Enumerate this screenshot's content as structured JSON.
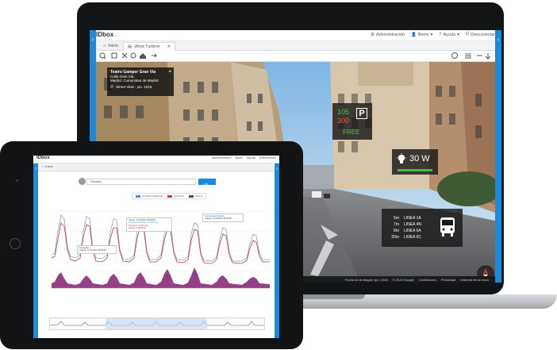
{
  "desktop_app": {
    "logo": "IDbox",
    "logo_suffix": "...",
    "menu": {
      "admin": "Administración",
      "user": "Bienv",
      "help": "Ayuda",
      "logout": "Desconectar"
    },
    "tabs": [
      {
        "label": "Inicio"
      },
      {
        "label": "Wind Turbine"
      }
    ],
    "place_card": {
      "title": "Teatro Gamper Gran Vía",
      "line1": "Calle Gran Vía",
      "line2": "Madrid, Comunidad de Madrid",
      "line3": "Street View - jun. 2016"
    },
    "parking": {
      "count_a": "105",
      "count_b": "300",
      "status": "FREE",
      "symbol": "P"
    },
    "streetlight": {
      "power": "30 W"
    },
    "bus_schedule": [
      {
        "time": "5m",
        "line": "LINEA 1A"
      },
      {
        "time": "7m",
        "line": "LINEA 4N"
      },
      {
        "time": "8m",
        "line": "LINEA 6A"
      },
      {
        "time": "20m",
        "line": "LINEA 6C"
      }
    ],
    "footer": {
      "date": "Fecha de la imagen: jun. 2016",
      "copyright": "© 2019 Google",
      "conditions": "Condiciones",
      "privacy": "Privacidad",
      "report": "Informar de un error"
    },
    "colors": {
      "accent": "#1c8ad8",
      "available": "#42c24a",
      "occupied": "#ff5a3c"
    }
  },
  "tablet_app": {
    "logo": "IDbox",
    "logo_suffix": "...",
    "menu": {
      "admin": "Administración",
      "user": "Bienv",
      "help": "Ayuda",
      "logout": "Desconectar"
    },
    "tab": "Inicio",
    "search": {
      "value": "Variable"
    },
    "legend": [
      {
        "label": "Consumo Estimado",
        "color": "#4f8fd9"
      },
      {
        "label": "Consumo",
        "color": "#c83c3c"
      },
      {
        "label": "Desvío",
        "color": "#8a2a7a"
      }
    ],
    "tooltip_left": {
      "title": "Consumo",
      "l1": "Jueves, 17 Octubre 18:00:00"
    },
    "tooltip_mid": {
      "l1": "Jueves, 17 Octubre 18:00:00",
      "l2": "Consumo Estimado: 11,100 Kwh",
      "l3": "Consumo: 9,000 Kwh",
      "l4": "Desvío: 2,100 Kwh"
    },
    "tooltip_right": {
      "title": "Consumo Estimado",
      "l1": "Jueves, 17 Octubre 18:00:00"
    }
  }
}
